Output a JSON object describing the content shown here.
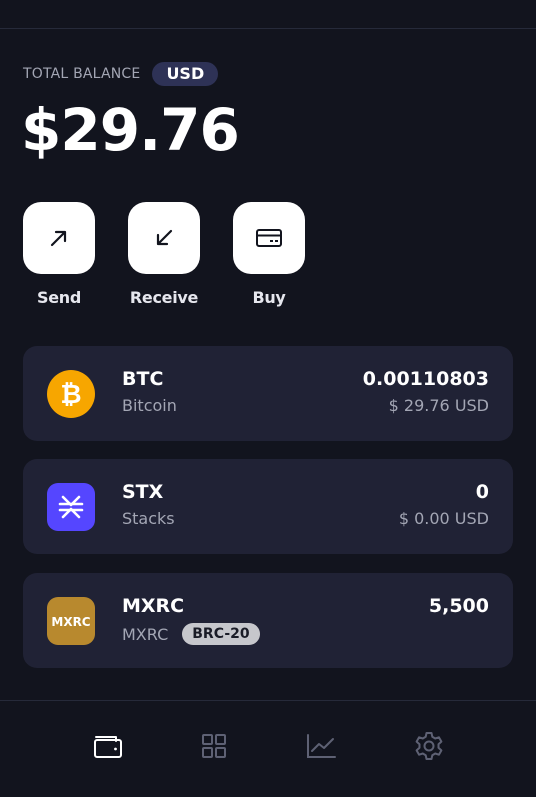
{
  "balance": {
    "label": "TOTAL BALANCE",
    "currency": "USD",
    "amount": "$29.76"
  },
  "actions": [
    {
      "label": "Send",
      "icon": "arrow-up-right-icon"
    },
    {
      "label": "Receive",
      "icon": "arrow-down-left-icon"
    },
    {
      "label": "Buy",
      "icon": "card-icon"
    }
  ],
  "assets": [
    {
      "ticker": "BTC",
      "name": "Bitcoin",
      "amount": "0.00110803",
      "fiat": "$ 29.76 USD",
      "icon": "bitcoin-icon",
      "color": "#f7a600"
    },
    {
      "ticker": "STX",
      "name": "Stacks",
      "amount": "0",
      "fiat": "$ 0.00 USD",
      "icon": "stacks-icon",
      "color": "#5546ff"
    },
    {
      "ticker": "MXRC",
      "name": "MXRC",
      "amount": "5,500",
      "badge": "BRC-20",
      "icon_text": "MXRC",
      "icon": "mxrc-token-icon",
      "color": "#b8892e"
    }
  ],
  "nav": [
    {
      "icon": "wallet-icon",
      "active": true
    },
    {
      "icon": "grid-icon",
      "active": false
    },
    {
      "icon": "chart-icon",
      "active": false
    },
    {
      "icon": "settings-icon",
      "active": false
    }
  ],
  "colors": {
    "background": "#12141e",
    "card": "#202235",
    "muted_text": "#a3a6b4",
    "currency_badge": "#2e3256"
  }
}
